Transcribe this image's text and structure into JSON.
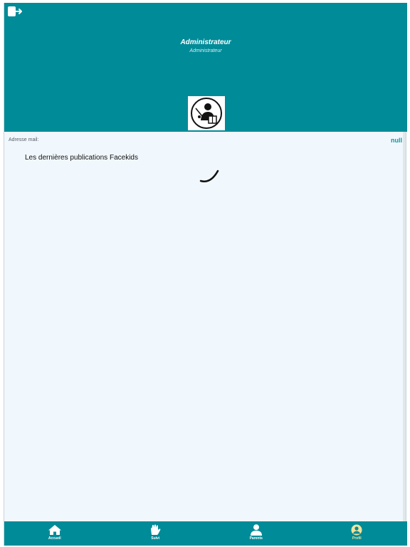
{
  "header": {
    "title": "Administrateur",
    "subtitle": "Administrateur",
    "background": "#008b98"
  },
  "icons": {
    "logout": "logout-icon",
    "avatar": "admin-teacher-icon",
    "loading": "loading-spinner"
  },
  "profile": {
    "email_label": "Adresse mail:",
    "email_value": "null"
  },
  "feed": {
    "title": "Les dernières publications Facekids"
  },
  "tabbar": {
    "items": [
      {
        "label": "Accueil",
        "icon": "home-icon"
      },
      {
        "label": "Suivi",
        "icon": "hand-icon"
      },
      {
        "label": "Parents",
        "icon": "person-icon"
      },
      {
        "label": "Profil",
        "icon": "profile-circle-icon"
      }
    ],
    "active_index": 3,
    "active_color": "#f3e39a"
  }
}
